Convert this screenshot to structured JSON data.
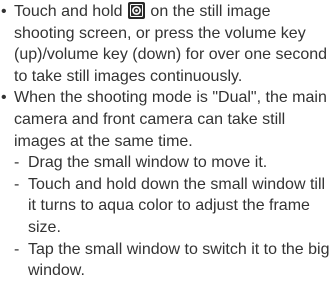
{
  "bullets": [
    {
      "marker": "•",
      "text_before_icon": "Touch and hold ",
      "icon": "camera-shutter-icon",
      "text_after_icon": " on the still image shooting screen, or press the volume key (up)/volume key (down) for over one second to take still images continuously."
    },
    {
      "marker": "•",
      "text": "When the shooting mode is \"Dual\", the main camera and front camera can take still images at the same time.",
      "sub_items": [
        {
          "marker": "-",
          "text": "Drag the small window to move it."
        },
        {
          "marker": "-",
          "text": "Touch and hold down the small window till it turns to aqua color to adjust the frame size."
        },
        {
          "marker": "-",
          "text": "Tap the small window to switch it to the big window."
        }
      ]
    }
  ],
  "colors": {
    "text": "#333333",
    "icon_bg": "#2a2a2a",
    "icon_fg": "#ffffff"
  }
}
